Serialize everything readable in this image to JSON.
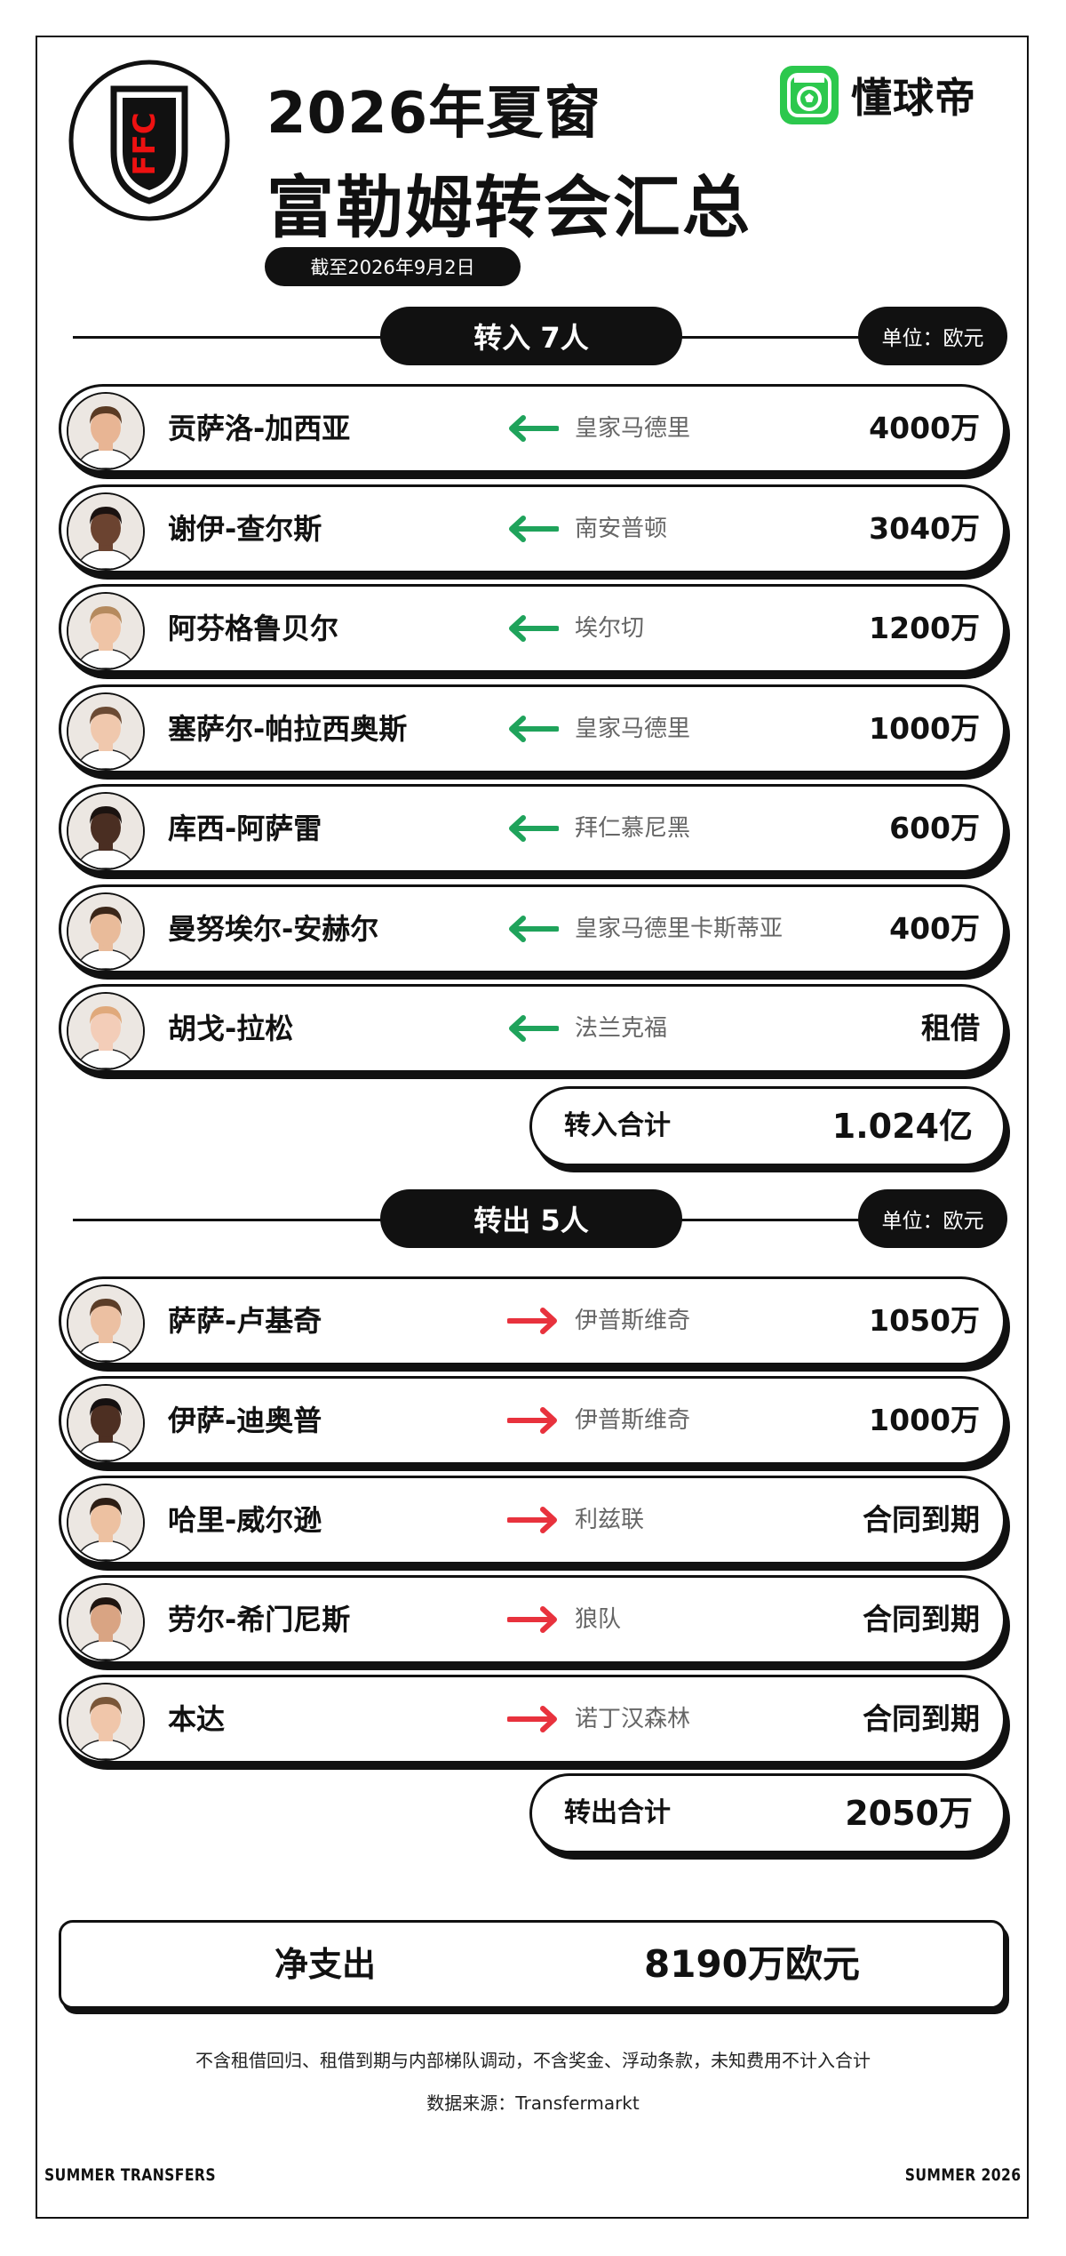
{
  "header": {
    "title_line1": "2026年夏窗",
    "title_line2": "富勒姆转会汇总",
    "date": "截至2026年9月2日",
    "brand": "懂球帝",
    "club_badge_text": "FFC"
  },
  "colors": {
    "in_arrow": "#1fa35b",
    "out_arrow": "#e8323d",
    "brand": "#2cc84d"
  },
  "transfers_in": {
    "label": "转入 7人",
    "unit": "单位：欧元",
    "rows": [
      {
        "name": "贡萨洛-加西亚",
        "club": "皇家马德里",
        "fee": "4000万",
        "skin": "#e8b594",
        "hair": "#5a3a23"
      },
      {
        "name": "谢伊-查尔斯",
        "club": "南安普顿",
        "fee": "3040万",
        "skin": "#6b4330",
        "hair": "#1a1210"
      },
      {
        "name": "阿芬格鲁贝尔",
        "club": "埃尔切",
        "fee": "1200万",
        "skin": "#efc4a6",
        "hair": "#b58a5e"
      },
      {
        "name": "塞萨尔-帕拉西奥斯",
        "club": "皇家马德里",
        "fee": "1000万",
        "skin": "#f0c8ad",
        "hair": "#6b4a33"
      },
      {
        "name": "库西-阿萨雷",
        "club": "拜仁慕尼黑",
        "fee": "600万",
        "skin": "#4a2e22",
        "hair": "#1b1310"
      },
      {
        "name": "曼努埃尔-安赫尔",
        "club": "皇家马德里卡斯蒂亚",
        "fee": "400万",
        "skin": "#e9bb9a",
        "hair": "#3b2618"
      },
      {
        "name": "胡戈-拉松",
        "club": "法兰克福",
        "fee": "租借",
        "skin": "#f3cdb8",
        "hair": "#e0a97b"
      }
    ],
    "total_label": "转入合计",
    "total_value": "1.024亿"
  },
  "transfers_out": {
    "label": "转出 5人",
    "unit": "单位：欧元",
    "rows": [
      {
        "name": "萨萨-卢基奇",
        "club": "伊普斯维奇",
        "fee": "1050万",
        "skin": "#ecc0a2",
        "hair": "#5b3d28"
      },
      {
        "name": "伊萨-迪奥普",
        "club": "伊普斯维奇",
        "fee": "1000万",
        "skin": "#4d2f22",
        "hair": "#151010"
      },
      {
        "name": "哈里-威尔逊",
        "club": "利兹联",
        "fee": "合同到期",
        "skin": "#edc1a1",
        "hair": "#2d1e15"
      },
      {
        "name": "劳尔-希门尼斯",
        "club": "狼队",
        "fee": "合同到期",
        "skin": "#d9a483",
        "hair": "#1f1510"
      },
      {
        "name": "本达",
        "club": "诺丁汉森林",
        "fee": "合同到期",
        "skin": "#f0c6aa",
        "hair": "#7a5638"
      }
    ],
    "total_label": "转出合计",
    "total_value": "2050万"
  },
  "net": {
    "label": "净支出",
    "value": "8190万欧元"
  },
  "notes": {
    "line1": "不含租借回归、租借到期与内部梯队调动，不含奖金、浮动条款，未知费用不计入合计",
    "line2": "数据来源：Transfermarkt"
  },
  "footer": {
    "left": "SUMMER TRANSFERS",
    "right": "SUMMER 2026"
  }
}
